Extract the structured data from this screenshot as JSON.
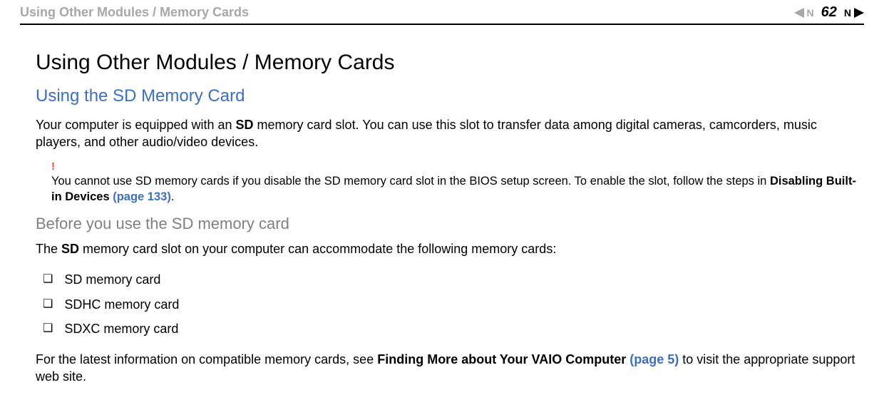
{
  "header": {
    "breadcrumb": "Using Other Modules / Memory Cards",
    "page_number": "62"
  },
  "title": "Using Other Modules / Memory Cards",
  "subtitle": "Using the SD Memory Card",
  "intro": {
    "pre": "Your computer is equipped with an ",
    "bold": "SD",
    "post": " memory card slot. You can use this slot to transfer data among digital cameras, camcorders, music players, and other audio/video devices."
  },
  "note": {
    "bang": "!",
    "text_pre": "You cannot use SD memory cards if you disable the SD memory card slot in the BIOS setup screen. To enable the slot, follow the steps in ",
    "link_bold": "Disabling Built-in Devices ",
    "link_page": "(page 133)",
    "text_post": "."
  },
  "section_heading": "Before you use the SD memory card",
  "section_intro": {
    "pre": "The ",
    "bold": "SD",
    "post": " memory card slot on your computer can accommodate the following memory cards:"
  },
  "cards": [
    "SD memory card",
    "SDHC memory card",
    "SDXC memory card"
  ],
  "footer": {
    "pre": "For the latest information on compatible memory cards, see ",
    "bold": "Finding More about Your VAIO Computer ",
    "link_page": "(page 5)",
    "post": " to visit the appropriate support web site."
  }
}
